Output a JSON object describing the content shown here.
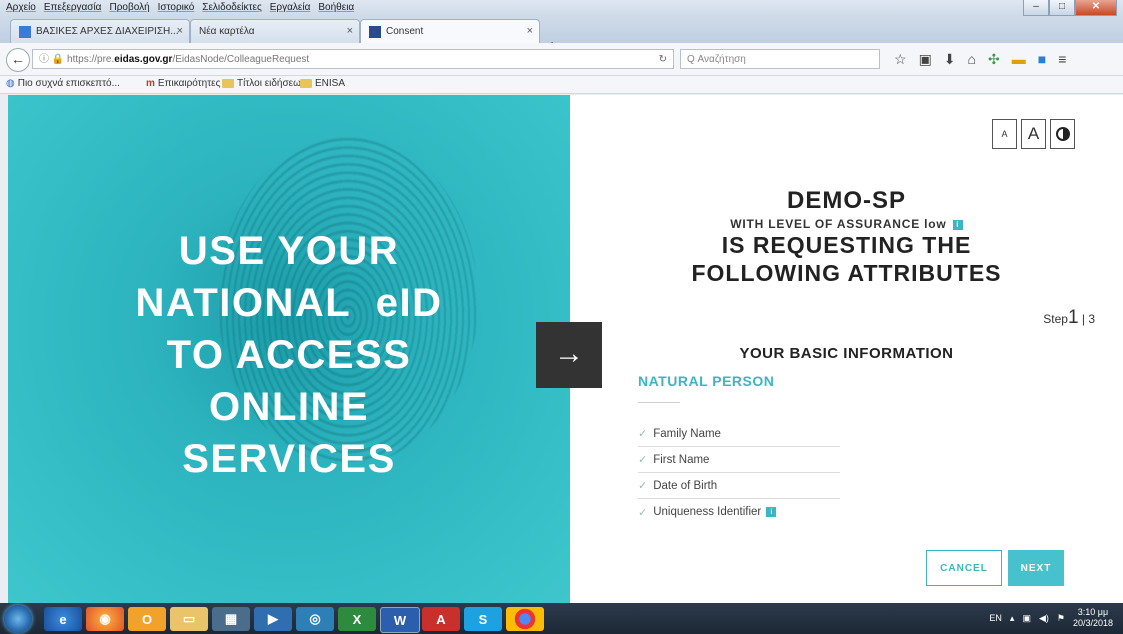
{
  "browser": {
    "menu": [
      "Αρχείο",
      "Επεξεργασία",
      "Προβολή",
      "Ιστορικό",
      "Σελιδοδείκτες",
      "Εργαλεία",
      "Βοήθεια"
    ],
    "window_controls": {
      "minimize": "–",
      "maximize": "□",
      "close": "✕"
    },
    "tabs": [
      {
        "title": "ΒΑΣΙΚΕΣ ΑΡΧΕΣ ΔΙΑΧΕΙΡΙΣΗ..."
      },
      {
        "title": "Νέα καρτέλα"
      },
      {
        "title": "Consent"
      }
    ],
    "url": {
      "prefix": "https://pre.",
      "host": "eidas.gov.gr",
      "path": "/EidasNode/ColleagueRequest"
    },
    "search_placeholder": "Q Αναζήτηση",
    "bookmarks": [
      "Πιο συχνά επισκεπτό...",
      "Επικαιρότητες",
      "Τίτλοι ειδήσεων",
      "ENISA"
    ]
  },
  "hero": {
    "lines": [
      "USE YOUR",
      "NATIONAL  eID",
      "TO ACCESS",
      "ONLINE",
      "SERVICES"
    ]
  },
  "colors": {
    "accent": "#3cb6c4",
    "hero_bg": "#2cb3be",
    "arrow_bg": "#333333"
  },
  "consent": {
    "font_small": "A",
    "font_large": "A",
    "sp_name": "DEMO-SP",
    "loa_prefix": "WITH LEVEL OF ASSURANCE",
    "loa_value": "low",
    "info_badge": "i",
    "requesting_line1": "IS REQUESTING THE",
    "requesting_line2": "FOLLOWING ATTRIBUTES",
    "step_label": "Step",
    "step_current": "1",
    "step_total": "| 3",
    "section_title": "YOUR BASIC INFORMATION",
    "subsection": "NATURAL PERSON",
    "attributes": [
      "Family Name",
      "First Name",
      "Date of Birth",
      "Uniqueness Identifier"
    ],
    "cancel_label": "CANCEL",
    "next_label": "NEXT"
  },
  "taskbar": {
    "clock_time": "3:10 μμ",
    "clock_date": "20/3/2018",
    "lang": "EN"
  }
}
